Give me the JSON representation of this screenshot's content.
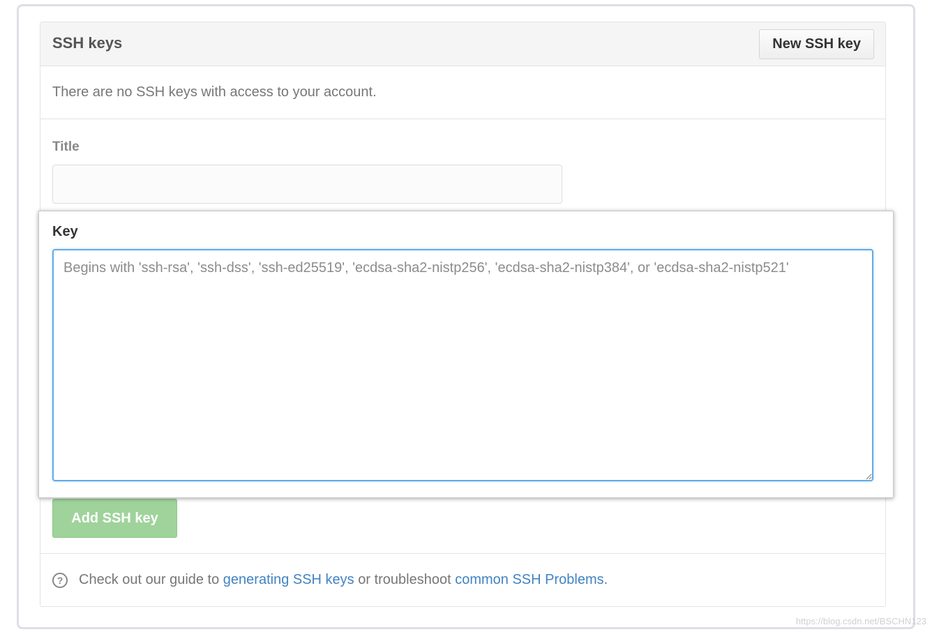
{
  "header": {
    "title": "SSH keys",
    "new_key_button": "New SSH key"
  },
  "empty_state": {
    "text": "There are no SSH keys with access to your account."
  },
  "form": {
    "title_label": "Title",
    "title_value": "",
    "key_label": "Key",
    "key_value": "",
    "key_placeholder": "Begins with 'ssh-rsa', 'ssh-dss', 'ssh-ed25519', 'ecdsa-sha2-nistp256', 'ecdsa-sha2-nistp384', or 'ecdsa-sha2-nistp521'",
    "submit_label": "Add SSH key"
  },
  "footer": {
    "help_icon_glyph": "?",
    "text_before": "Check out our guide to ",
    "link_generating": "generating SSH keys",
    "text_middle": " or troubleshoot ",
    "link_problems": "common SSH Problems",
    "text_after": "."
  },
  "watermark": "https://blog.csdn.net/BSCHN123",
  "colors": {
    "link": "#4183c4",
    "submit_disabled": "#9fd39b",
    "focus_border": "#62aaea"
  },
  "icons": {
    "help": "question-circle-icon"
  }
}
